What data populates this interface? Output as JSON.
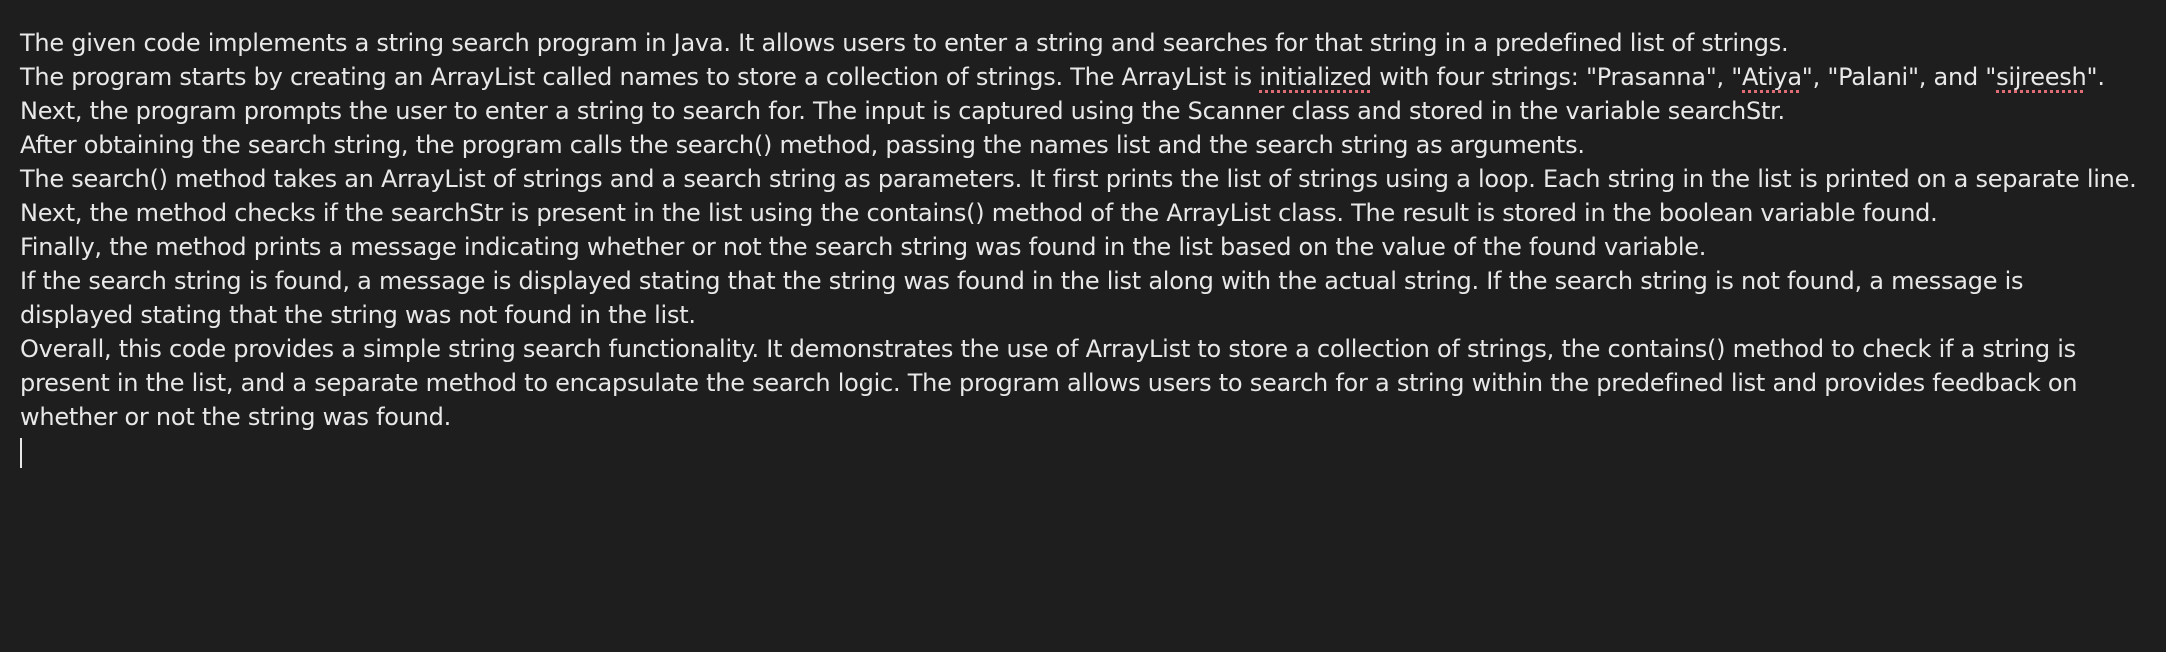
{
  "document": {
    "paragraphs": [
      {
        "segments": [
          {
            "text": "The given code implements a string search program in Java. It allows users to enter a string and searches for that string in a predefined list of strings."
          }
        ]
      },
      {
        "segments": [
          {
            "text": "The program starts by creating an ArrayList called names to store a collection of strings. The ArrayList is "
          },
          {
            "text": "initialized",
            "misspelled": true
          },
          {
            "text": " with four strings: \"Prasanna\", \""
          },
          {
            "text": "Atiya",
            "misspelled": true
          },
          {
            "text": "\", \"Palani\", and \""
          },
          {
            "text": "sijreesh",
            "misspelled": true
          },
          {
            "text": "\"."
          }
        ]
      },
      {
        "segments": [
          {
            "text": "Next, the program prompts the user to enter a string to search for. The input is captured using the Scanner class and stored in the variable searchStr."
          }
        ]
      },
      {
        "segments": [
          {
            "text": "After obtaining the search string, the program calls the search() method, passing the names list and the search string as arguments."
          }
        ]
      },
      {
        "segments": [
          {
            "text": "The search() method takes an ArrayList of strings and a search string as parameters. It first prints the list of strings using a loop. Each string in the list is printed on a separate line."
          }
        ]
      },
      {
        "segments": [
          {
            "text": "Next, the method checks if the searchStr is present in the list using the contains() method of the ArrayList class. The result is stored in the boolean variable found."
          }
        ]
      },
      {
        "segments": [
          {
            "text": "Finally, the method prints a message indicating whether or not the search string was found in the list based on the value of the found variable."
          }
        ]
      },
      {
        "segments": [
          {
            "text": "If the search string is found, a message is displayed stating that the string was found in the list along with the actual string. If the search string is not found, a message is displayed stating that the string was not found in the list."
          }
        ]
      },
      {
        "segments": [
          {
            "text": "Overall, this code provides a simple string search functionality. It demonstrates the use of ArrayList to store a collection of strings, the contains() method to check if a string is present in the list, and a separate method to encapsulate the search logic. The program allows users to search for a string within the predefined list and provides feedback on whether or not the string was found."
          }
        ]
      }
    ]
  },
  "colors": {
    "background": "#1e1e1e",
    "text": "#e8e8e8",
    "spellcheck_underline": "#e06c75"
  }
}
